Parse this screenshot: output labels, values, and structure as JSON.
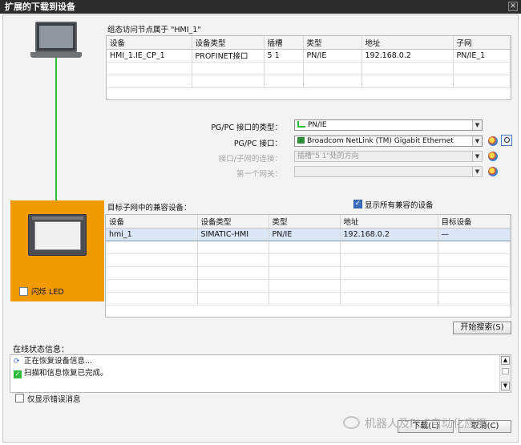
{
  "window": {
    "title": "扩展的下载到设备"
  },
  "access_node": {
    "caption": "组态访问节点属于 \"HMI_1\"",
    "columns": [
      "设备",
      "设备类型",
      "插槽",
      "类型",
      "地址",
      "子网"
    ],
    "rows": [
      [
        "HMI_1.IE_CP_1",
        "PROFINET接口",
        "5 1",
        "PN/IE",
        "192.168.0.2",
        "PN/IE_1"
      ]
    ]
  },
  "settings": {
    "pgpc_type_label": "PG/PC 接口的类型：",
    "pgpc_type_value": "PN/IE",
    "pgpc_iface_label": "PG/PC 接口：",
    "pgpc_iface_value": "Broadcom NetLink (TM) Gigabit Ethernet",
    "subnet_conn_label": "接口/子网的连接：",
    "subnet_conn_value": "插槽\"5 1\"处的方向",
    "gateway_label": "第一个网关：",
    "gateway_value": ""
  },
  "target": {
    "caption": "目标子网中的兼容设备：",
    "show_all_label": "显示所有兼容的设备",
    "show_all_checked": true,
    "columns": [
      "设备",
      "设备类型",
      "类型",
      "地址",
      "目标设备"
    ],
    "rows": [
      [
        "hmi_1",
        "SIMATIC-HMI",
        "PN/IE",
        "192.168.0.2",
        "—"
      ]
    ]
  },
  "flash_led_label": "闪烁 LED",
  "start_search_label": "开始搜索(S)",
  "online_status": {
    "caption": "在线状态信息：",
    "messages": [
      "正在恢复设备信息...",
      "扫描和信息恢复已完成。"
    ]
  },
  "show_errors_label": "仅显示错误消息",
  "buttons": {
    "load": "下载(L)",
    "cancel": "取消(C)"
  },
  "watermark": "机器人及PLC自动化应用",
  "colors": {
    "device_panel": "#f39a00",
    "connection_line": "#2dbb3a",
    "selected_row": "#dbe6f7",
    "title_bar": "#2c2c2c"
  }
}
